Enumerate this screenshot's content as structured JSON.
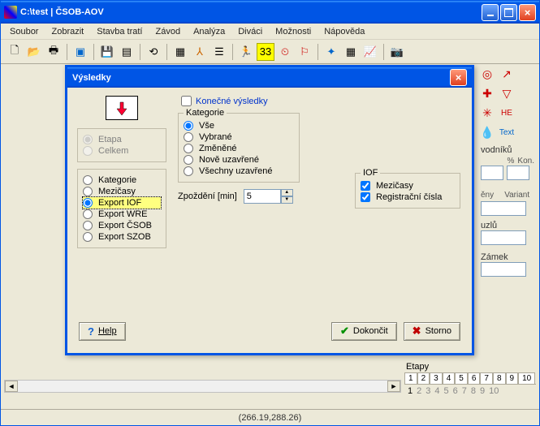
{
  "window": {
    "title": "C:\\test | ČSOB-AOV"
  },
  "menu": [
    "Soubor",
    "Zobrazit",
    "Stavba tratí",
    "Závod",
    "Analýza",
    "Diváci",
    "Možnosti",
    "Nápověda"
  ],
  "right": {
    "label_vodniku": "vodníků",
    "label_pct": "%",
    "label_kon": "Kon.",
    "label_eny": "ěny",
    "label_variant": "Variant",
    "label_uzlu": "uzlů",
    "label_zamek": "Zámek",
    "text_label": "Text",
    "he_label": "HE"
  },
  "etapy": {
    "caption": "Etapy",
    "tabs": [
      "1",
      "2",
      "3",
      "4",
      "5",
      "6",
      "7",
      "8",
      "9",
      "10"
    ],
    "nums": [
      "1",
      "2",
      "3",
      "4",
      "5",
      "6",
      "7",
      "8",
      "9",
      "10"
    ]
  },
  "status": "(266.19,288.26)",
  "dialog": {
    "title": "Výsledky",
    "konecne": "Konečné výsledky",
    "etapa_group": {
      "etapa": "Etapa",
      "celkem": "Celkem"
    },
    "left_radios": [
      "Kategorie",
      "Mezičasy",
      "Export IOF",
      "Export WRE",
      "Export ČSOB",
      "Export SZOB"
    ],
    "left_selected": 2,
    "kategorie": {
      "label": "Kategorie",
      "options": [
        "Vše",
        "Vybrané",
        "Změněné",
        "Nově uzavřené",
        "Všechny uzavřené"
      ],
      "selected": 0
    },
    "zpozdeni_label": "Zpoždění [min]",
    "zpozdeni_value": "5",
    "iof": {
      "label": "IOF",
      "mezicasy": "Mezičasy",
      "reg": "Registrační čísla"
    },
    "buttons": {
      "help": "Help",
      "ok": "Dokončit",
      "cancel": "Storno"
    }
  }
}
